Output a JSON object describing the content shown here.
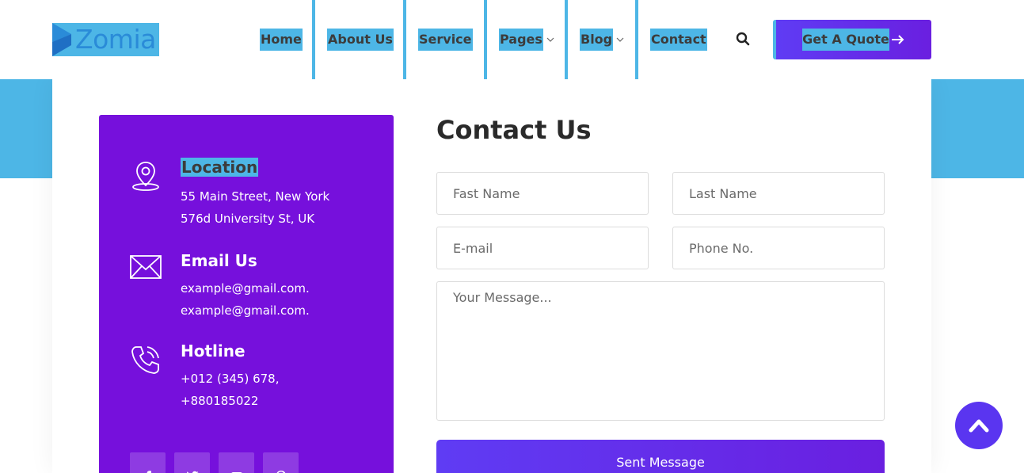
{
  "brand": {
    "name": "Zomia"
  },
  "nav": {
    "items": [
      {
        "label": "Home"
      },
      {
        "label": "About Us"
      },
      {
        "label": "Service"
      },
      {
        "label": "Pages"
      },
      {
        "label": "Blog"
      },
      {
        "label": "Contact"
      }
    ],
    "quote_label": "Get A Quote"
  },
  "info": {
    "location": {
      "title": "Location",
      "lines": [
        "55 Main Street, New York",
        "576d University St, UK"
      ]
    },
    "email": {
      "title": "Email Us",
      "lines": [
        "example@gmail.com.",
        "example@gmail.com."
      ]
    },
    "hotline": {
      "title": "Hotline",
      "lines": [
        "+012 (345) 678,",
        "+880185022"
      ]
    },
    "social": [
      "facebook-icon",
      "twitter-icon",
      "youtube-icon",
      "pinterest-icon"
    ]
  },
  "form": {
    "title": "Contact Us",
    "first_name_placeholder": "Fast Name",
    "last_name_placeholder": "Last Name",
    "email_placeholder": "E-mail",
    "phone_placeholder": "Phone No.",
    "message_placeholder": "Your Message...",
    "submit_label": "Sent Message"
  },
  "colors": {
    "accent": "#7610dc",
    "highlight": "#4db6e6",
    "button": "#5f3cf4"
  }
}
